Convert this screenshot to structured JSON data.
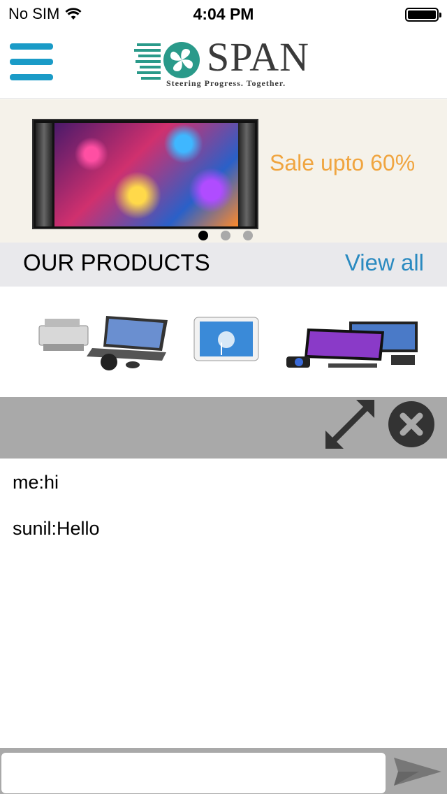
{
  "status_bar": {
    "carrier": "No SIM",
    "time": "4:04 PM",
    "icons": [
      "wifi-icon",
      "battery-icon"
    ]
  },
  "header": {
    "logo_name": "SPAN",
    "logo_tagline": "Steering Progress. Together.",
    "icons": [
      "menu-icon",
      "logo-icon"
    ]
  },
  "banner": {
    "promo_text": "Sale upto 60%",
    "slide_count": 3,
    "active_slide": 1
  },
  "products": {
    "title": "OUR PRODUCTS",
    "view_all_label": "View all",
    "items": [
      "printer-laptop-product",
      "tablet-product",
      "monitors-product"
    ]
  },
  "chat": {
    "toolbar_icons": [
      "expand-icon",
      "close-icon"
    ],
    "messages": [
      {
        "text": "me:hi"
      },
      {
        "text": "sunil:Hello"
      }
    ],
    "input": {
      "value": "",
      "placeholder": ""
    },
    "send_icon": "send-icon"
  },
  "colors": {
    "brand_teal": "#1a9bc7",
    "promo_orange": "#f0a540",
    "link_blue": "#2a8ac0",
    "banner_bg": "#f5f2ea",
    "products_bar_bg": "#e9e9ec",
    "chat_toolbar_bg": "#a9a9a9"
  }
}
